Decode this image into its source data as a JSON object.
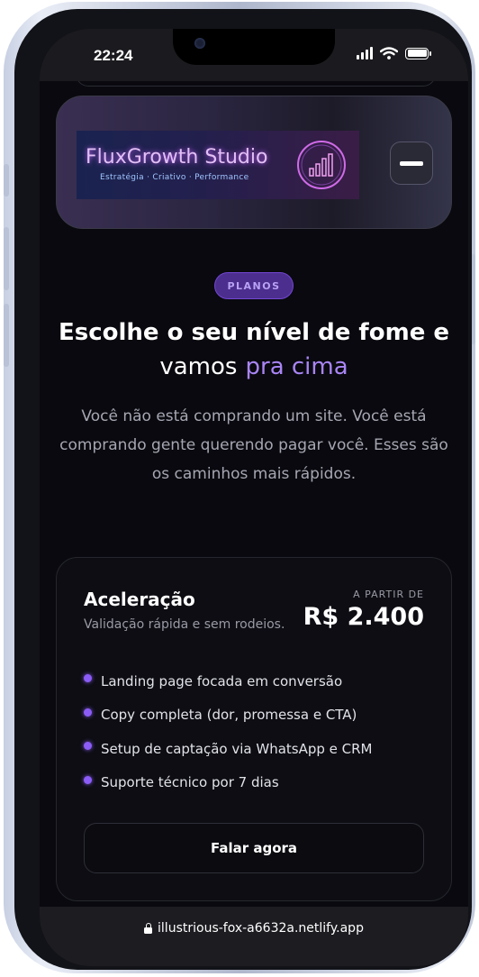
{
  "status_bar": {
    "time": "22:24"
  },
  "header": {
    "logo_title": "FluxGrowth Studio",
    "logo_subtitle": "Estratégia · Criativo · Performance",
    "menu_icon": "menu-icon"
  },
  "section": {
    "badge": "PLANOS",
    "headline_line1": "Escolhe o seu nível de fome e",
    "headline_word": "vamos",
    "headline_highlight": "pra cima",
    "description": "Você não está comprando um site. Você está comprando gente querendo pagar você. Esses são os caminhos mais rápidos."
  },
  "plan": {
    "name": "Aceleração",
    "tagline": "Validação rápida e sem rodeios.",
    "price_label": "A PARTIR DE",
    "price": "R$ 2.400",
    "features": [
      "Landing page focada em conversão",
      "Copy completa (dor, promessa e CTA)",
      "Setup de captação via WhatsApp e CRM",
      "Suporte técnico por 7 dias"
    ],
    "cta": "Falar agora"
  },
  "browser": {
    "url": "illustrious-fox-a6632a.netlify.app"
  },
  "colors": {
    "accent": "#a985f5",
    "bullet": "#8b5cf6",
    "background": "#09090f"
  }
}
